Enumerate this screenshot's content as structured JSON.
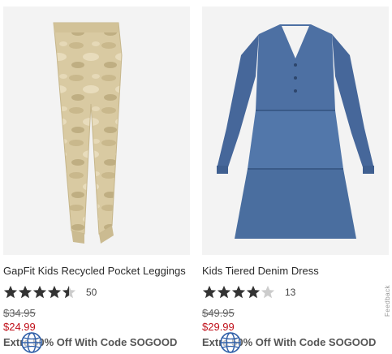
{
  "products": [
    {
      "title": "GapFit Kids Recycled Pocket Leggings",
      "rating": 4.5,
      "review_count": "50",
      "original_price": "$34.95",
      "sale_price": "$24.99",
      "promo": "Extra 50% Off With Code SOGOOD",
      "image_icon": "leggings-camo-image"
    },
    {
      "title": "Kids Tiered Denim Dress",
      "rating": 4.0,
      "review_count": "13",
      "original_price": "$49.95",
      "sale_price": "$29.99",
      "promo": "Extra 50% Off With Code SOGOOD",
      "image_icon": "denim-dress-image"
    }
  ],
  "feedback_tab": "Feedback",
  "colors": {
    "sale": "#c0101a",
    "star": "#333333",
    "star_empty": "#cccccc",
    "denim": "#4a6e9c",
    "camo": "#d8c9a3"
  }
}
